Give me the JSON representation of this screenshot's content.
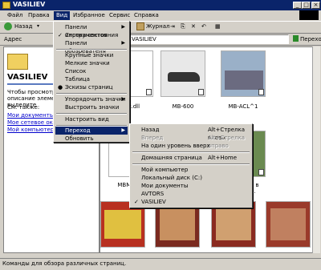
{
  "window": {
    "title": "VASILIEV",
    "min": "_",
    "max": "□",
    "close": "×"
  },
  "menubar": {
    "items": [
      "Файл",
      "Правка",
      "Вид",
      "Избранное",
      "Сервис",
      "Справка"
    ]
  },
  "toolbar": {
    "back": "Назад",
    "journal": "Журнал"
  },
  "address": {
    "label": "Адрес",
    "value": "VASILIEV",
    "go": "Переход"
  },
  "left_panel": {
    "folder_name": "VASILIEV",
    "description": "Чтобы просмотреть описание элемента, выделите",
    "see_also": "См. также:",
    "links": [
      "Мои документы",
      "Мое сетевое окружение",
      "Мой компьютер"
    ]
  },
  "thumbnails": {
    "row1": [
      {
        "label": "...ket.dll"
      },
      {
        "label": "MB-600"
      },
      {
        "label": "MB-ACL^1"
      }
    ],
    "row2": [
      {
        "label": "MBM^1"
      },
      {
        "label": ""
      },
      {
        "label": "...южеты в искусс..."
      }
    ]
  },
  "view_menu": {
    "items": [
      {
        "label": "Панели инструментов",
        "submenu": true
      },
      {
        "label": "Строка состояния",
        "checked": true
      },
      {
        "label": "Панели обозревателя",
        "submenu": true
      },
      {
        "sep": true
      },
      {
        "label": "Крупные значки"
      },
      {
        "label": "Мелкие значки"
      },
      {
        "label": "Список"
      },
      {
        "label": "Таблица"
      },
      {
        "label": "Эскизы страниц",
        "bullet": true
      },
      {
        "sep": true
      },
      {
        "label": "Упорядочить значки",
        "submenu": true
      },
      {
        "label": "Выстроить значки"
      },
      {
        "sep": true
      },
      {
        "label": "Настроить вид папки..."
      },
      {
        "sep": true
      },
      {
        "label": "Переход",
        "submenu": true,
        "highlight": true
      },
      {
        "label": "Обновить"
      }
    ]
  },
  "goto_menu": {
    "items": [
      {
        "label": "Назад",
        "accel": "Alt+Стрелка влево"
      },
      {
        "label": "Вперед",
        "accel": "Alt+Стрелка вправо",
        "disabled": true
      },
      {
        "label": "На один уровень вверх"
      },
      {
        "sep": true
      },
      {
        "label": "Домашняя страница",
        "accel": "Alt+Home"
      },
      {
        "sep": true
      },
      {
        "label": "Мой компьютер"
      },
      {
        "label": "Локальный диск (C:)"
      },
      {
        "label": "Мои документы"
      },
      {
        "label": "AVTORS"
      },
      {
        "label": "VASILIEV",
        "checked": true
      }
    ]
  },
  "status": {
    "text": "Команды для обзора различных страниц."
  },
  "colors": {
    "titlebar": "#0a246a",
    "highlight": "#0a246a",
    "chrome": "#d4d0c8"
  }
}
